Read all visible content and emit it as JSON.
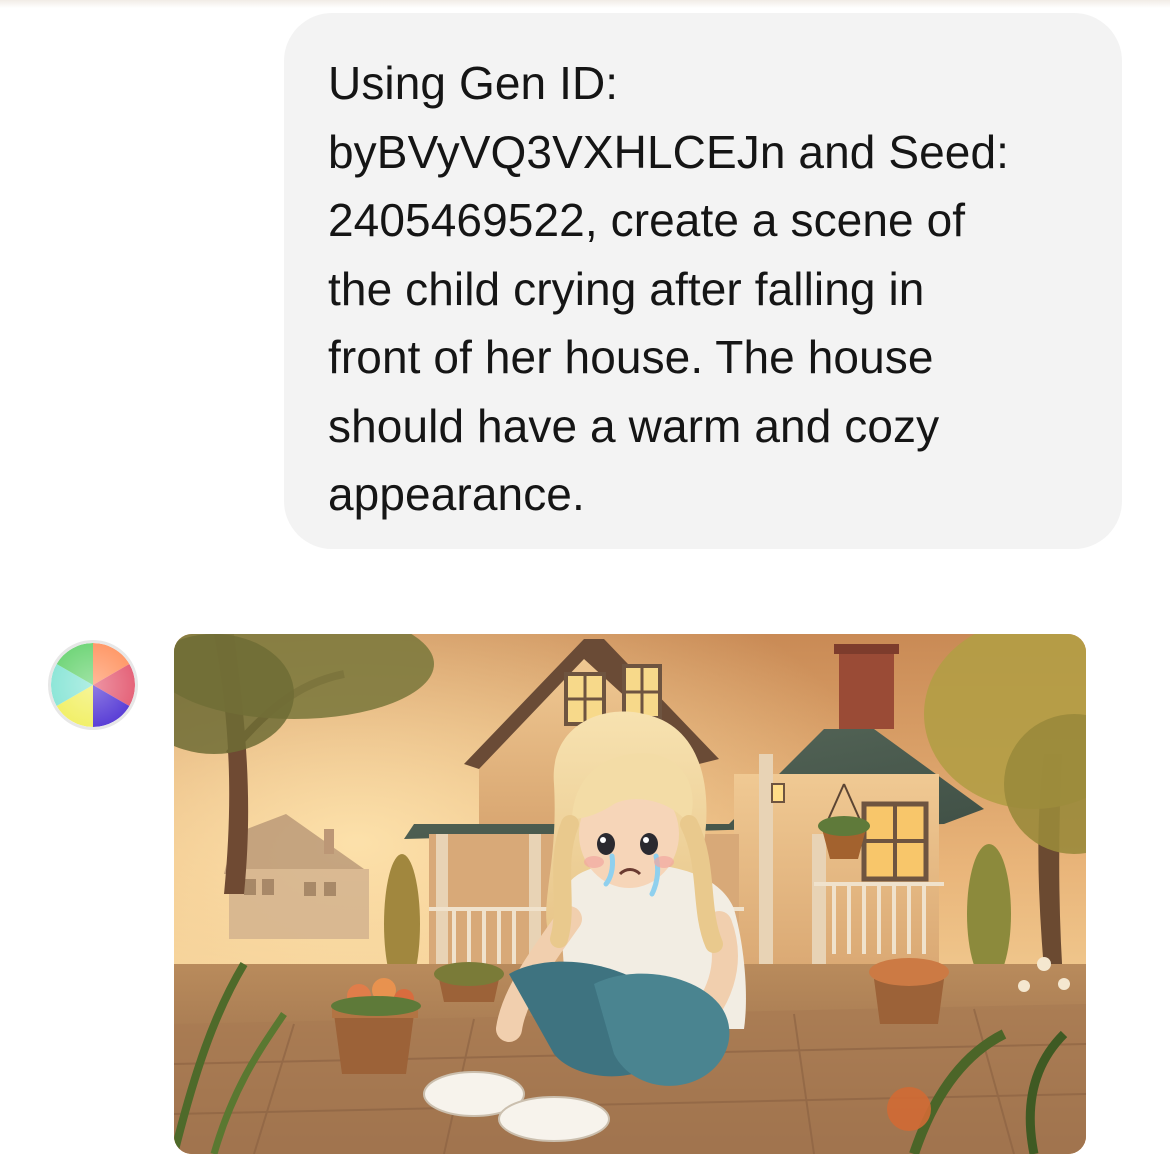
{
  "chat": {
    "user_message": {
      "text": "Using Gen ID:\nbyBVyVQ3VXHLCEJn and Seed:\n2405469522, create a scene of\nthe child crying after falling in\nfront of her house. The house\nshould have a warm and cozy\nappearance."
    },
    "assistant_message": {
      "avatar_icon": "assistant-avatar-icon",
      "image_icon": "generated-illustration"
    }
  },
  "colors": {
    "user_bubble_bg": "#f3f3f3",
    "text": "#151515",
    "page_bg": "#ffffff"
  }
}
